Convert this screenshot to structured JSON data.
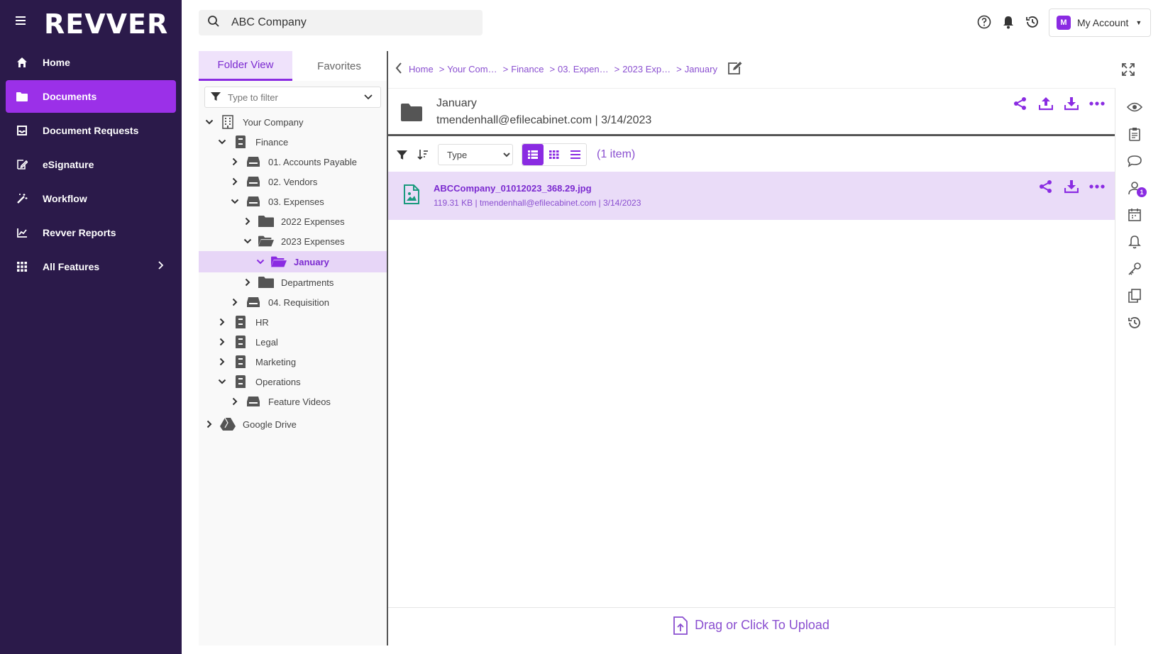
{
  "app": {
    "logo": "REVVER"
  },
  "nav": {
    "items": [
      {
        "label": "Home",
        "icon": "home-icon"
      },
      {
        "label": "Documents",
        "icon": "folder-icon",
        "active": true
      },
      {
        "label": "Document Requests",
        "icon": "inbox-icon"
      },
      {
        "label": "eSignature",
        "icon": "signature-icon"
      },
      {
        "label": "Workflow",
        "icon": "magic-wand-icon"
      },
      {
        "label": "Revver Reports",
        "icon": "chart-icon"
      },
      {
        "label": "All Features",
        "icon": "grid-icon"
      }
    ]
  },
  "search": {
    "value": "ABC Company"
  },
  "account": {
    "initial": "M",
    "label": "My Account"
  },
  "tree_panel": {
    "tabs": [
      "Folder View",
      "Favorites"
    ],
    "filter_placeholder": "Type to filter",
    "rows": [
      {
        "label": "Your Company",
        "type": "building",
        "expanded": true
      },
      {
        "label": "Finance",
        "type": "cabinet",
        "expanded": true
      },
      {
        "label": "01. Accounts Payable",
        "type": "drawer",
        "expanded": false
      },
      {
        "label": "02. Vendors",
        "type": "drawer",
        "expanded": false
      },
      {
        "label": "03. Expenses",
        "type": "drawer",
        "expanded": true
      },
      {
        "label": "2022 Expenses",
        "type": "folder",
        "expanded": false
      },
      {
        "label": "2023 Expenses",
        "type": "folder-open",
        "expanded": true
      },
      {
        "label": "January",
        "type": "folder-open",
        "expanded": true,
        "selected": true
      },
      {
        "label": "Departments",
        "type": "folder",
        "expanded": false
      },
      {
        "label": "04. Requisition",
        "type": "drawer",
        "expanded": false
      },
      {
        "label": "HR",
        "type": "cabinet",
        "expanded": false
      },
      {
        "label": "Legal",
        "type": "cabinet",
        "expanded": false
      },
      {
        "label": "Marketing",
        "type": "cabinet",
        "expanded": false
      },
      {
        "label": "Operations",
        "type": "cabinet",
        "expanded": true
      },
      {
        "label": "Feature Videos",
        "type": "drawer",
        "expanded": false
      },
      {
        "label": "Google Drive",
        "type": "google-drive",
        "expanded": false
      }
    ]
  },
  "breadcrumb": {
    "items": [
      "Home",
      "Your Com…",
      "Finance",
      "03. Expen…",
      "2023 Exp…",
      "January"
    ]
  },
  "folder": {
    "name": "January",
    "meta": "tmendenhall@efilecabinet.com | 3/14/2023"
  },
  "toolbar": {
    "sort_select": "Type",
    "sort_options": [
      "Type"
    ],
    "count": "(1 item)"
  },
  "files": [
    {
      "name": "ABCCompany_01012023_368.29.jpg",
      "meta": "119.31 KB | tmendenhall@efilecabinet.com | 3/14/2023"
    }
  ],
  "upload": {
    "label": "Drag or Click To Upload"
  },
  "right_rail": {
    "items": [
      "eye-icon",
      "clipboard-icon",
      "comment-icon",
      "user-icon",
      "calendar-icon",
      "bell-icon",
      "key-icon",
      "copy-icon",
      "history-icon"
    ],
    "user_badge": "1"
  },
  "colors": {
    "nav_bg": "#2b1a4a",
    "accent": "#8a2be2"
  }
}
